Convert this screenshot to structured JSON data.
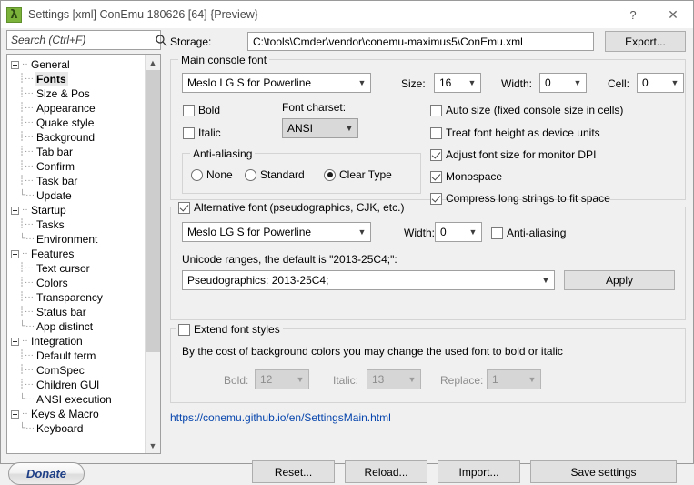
{
  "window": {
    "title": "Settings [xml] ConEmu 180626 [64] {Preview}",
    "icon": "lambda-icon",
    "help_label": "?",
    "close_label": "✕"
  },
  "search": {
    "placeholder": "Search (Ctrl+F)",
    "value": "",
    "icon": "search-icon"
  },
  "tree": {
    "selected": "Fonts",
    "groups": [
      {
        "label": "General",
        "expanded": true,
        "children": [
          "Fonts",
          "Size & Pos",
          "Appearance",
          "Quake style",
          "Background",
          "Tab bar",
          "Confirm",
          "Task bar",
          "Update"
        ]
      },
      {
        "label": "Startup",
        "expanded": true,
        "children": [
          "Tasks",
          "Environment"
        ]
      },
      {
        "label": "Features",
        "expanded": true,
        "children": [
          "Text cursor",
          "Colors",
          "Transparency",
          "Status bar",
          "App distinct"
        ]
      },
      {
        "label": "Integration",
        "expanded": true,
        "children": [
          "Default term",
          "ComSpec",
          "Children GUI",
          "ANSI execution"
        ]
      },
      {
        "label": "Keys & Macro",
        "expanded": true,
        "children": [
          "Keyboard"
        ]
      }
    ]
  },
  "donate": {
    "label": "Donate"
  },
  "storage": {
    "label": "Storage:",
    "value": "C:\\tools\\Cmder\\vendor\\conemu-maximus5\\ConEmu.xml",
    "export_label": "Export..."
  },
  "main_font": {
    "group_title": "Main console font",
    "font_name": "Meslo LG S for Powerline",
    "size_label": "Size:",
    "size_value": "16",
    "width_label": "Width:",
    "width_value": "0",
    "cell_label": "Cell:",
    "cell_value": "0",
    "bold_label": "Bold",
    "bold_checked": false,
    "italic_label": "Italic",
    "italic_checked": false,
    "charset_label": "Font charset:",
    "charset_value": "ANSI",
    "antialiasing": {
      "group_title": "Anti-aliasing",
      "options": [
        "None",
        "Standard",
        "Clear Type"
      ],
      "selected": "Clear Type"
    },
    "options": [
      {
        "label": "Auto size (fixed console size in cells)",
        "checked": false
      },
      {
        "label": "Treat font height as device units",
        "checked": false
      },
      {
        "label": "Adjust font size for monitor DPI",
        "checked": true
      },
      {
        "label": "Monospace",
        "checked": true
      },
      {
        "label": "Compress long strings to fit space",
        "checked": true
      }
    ]
  },
  "alt_font": {
    "title": "Alternative font (pseudographics, CJK, etc.)",
    "enabled": true,
    "font_name": "Meslo LG S for Powerline",
    "width_label": "Width:",
    "width_value": "0",
    "antialiasing_label": "Anti-aliasing",
    "antialiasing_checked": false,
    "ranges_label": "Unicode ranges, the default is \"2013-25C4;\":",
    "ranges_value": "Pseudographics: 2013-25C4;",
    "apply_label": "Apply"
  },
  "extend_styles": {
    "title": "Extend font styles",
    "enabled": false,
    "description": "By the cost of background colors you may change the used font to bold or italic",
    "bold_label": "Bold:",
    "bold_value": "12",
    "italic_label": "Italic:",
    "italic_value": "13",
    "replace_label": "Replace:",
    "replace_value": "1"
  },
  "help_link": "https://conemu.github.io/en/SettingsMain.html",
  "footer": {
    "reset_label": "Reset...",
    "reload_label": "Reload...",
    "import_label": "Import...",
    "save_label": "Save settings"
  }
}
